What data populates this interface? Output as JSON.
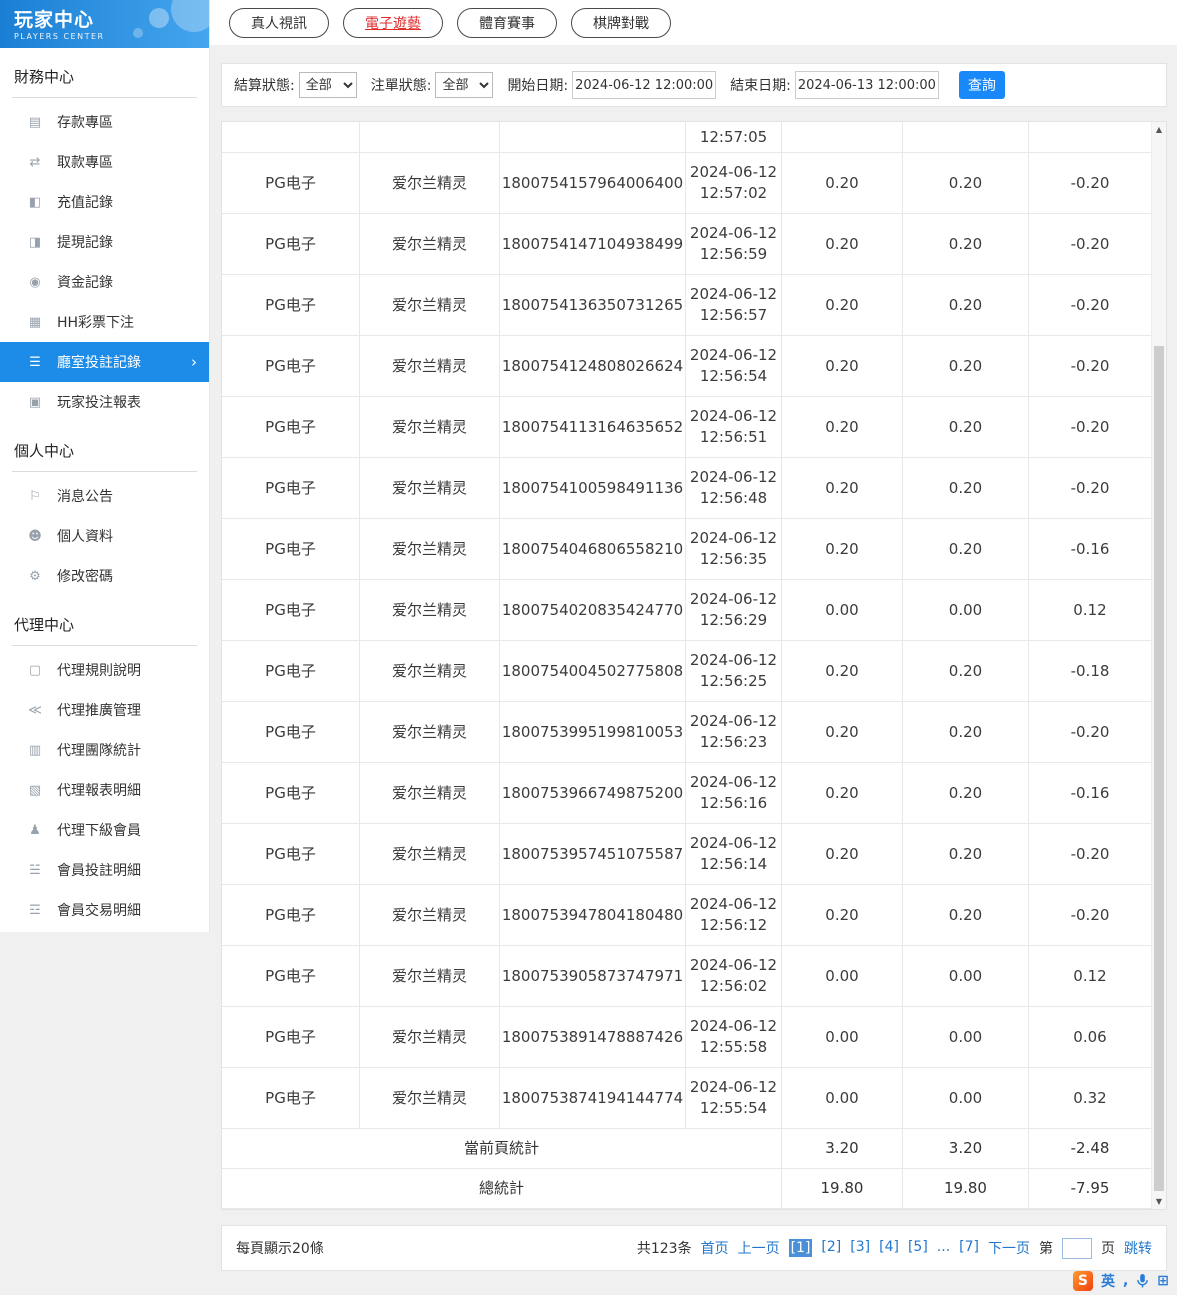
{
  "sidebar": {
    "logo_title": "玩家中心",
    "logo_subtitle": "PLAYERS CENTER",
    "sections": [
      {
        "id": "finance-center",
        "title": "財務中心",
        "items": [
          {
            "id": "deposit",
            "icon": "deposit-icon",
            "glyph": "▤",
            "label": "存款專區",
            "active": false
          },
          {
            "id": "withdraw",
            "icon": "withdraw-icon",
            "glyph": "⇄",
            "label": "取款專區",
            "active": false
          },
          {
            "id": "recharge-record",
            "icon": "recharge-record-icon",
            "glyph": "◧",
            "label": "充值記錄",
            "active": false
          },
          {
            "id": "withdrawal-record",
            "icon": "withdrawal-record-icon",
            "glyph": "◨",
            "label": "提現記錄",
            "active": false
          },
          {
            "id": "fund-record",
            "icon": "fund-record-icon",
            "glyph": "◉",
            "label": "資金記錄",
            "active": false
          },
          {
            "id": "hh-lottery-bet",
            "icon": "lottery-icon",
            "glyph": "▦",
            "label": "HH彩票下注",
            "active": false
          },
          {
            "id": "room-bet-record",
            "icon": "room-bet-record-icon",
            "glyph": "☰",
            "label": "廳室投註記錄",
            "active": true
          },
          {
            "id": "player-bet-report",
            "icon": "player-report-icon",
            "glyph": "▣",
            "label": "玩家投注報表",
            "active": false
          }
        ]
      },
      {
        "id": "personal-center",
        "title": "個人中心",
        "items": [
          {
            "id": "message-notice",
            "icon": "bell-icon",
            "glyph": "⚐",
            "label": "消息公告",
            "active": false
          },
          {
            "id": "personal-info",
            "icon": "user-icon",
            "glyph": "☻",
            "label": "個人資料",
            "active": false
          },
          {
            "id": "change-password",
            "icon": "gear-icon",
            "glyph": "⚙",
            "label": "修改密碼",
            "active": false
          }
        ]
      },
      {
        "id": "agent-center",
        "title": "代理中心",
        "items": [
          {
            "id": "agent-rules",
            "icon": "document-icon",
            "glyph": "▢",
            "label": "代理規則說明",
            "active": false
          },
          {
            "id": "agent-promotion",
            "icon": "share-icon",
            "glyph": "≪",
            "label": "代理推廣管理",
            "active": false
          },
          {
            "id": "agent-team-stats",
            "icon": "stats-icon",
            "glyph": "▥",
            "label": "代理團隊統計",
            "active": false
          },
          {
            "id": "agent-report-detail",
            "icon": "report-icon",
            "glyph": "▧",
            "label": "代理報表明細",
            "active": false
          },
          {
            "id": "agent-sub-members",
            "icon": "members-icon",
            "glyph": "♟",
            "label": "代理下級會員",
            "active": false
          },
          {
            "id": "member-bet-detail",
            "icon": "bet-detail-icon",
            "glyph": "☱",
            "label": "會員投註明細",
            "active": false
          },
          {
            "id": "member-transaction-detail",
            "icon": "transaction-icon",
            "glyph": "☲",
            "label": "會員交易明細",
            "active": false
          }
        ]
      }
    ]
  },
  "tabs": [
    {
      "id": "live-video",
      "label": "真人視訊",
      "active": false
    },
    {
      "id": "electronic-games",
      "label": "電子遊藝",
      "active": true
    },
    {
      "id": "sports-events",
      "label": "體育賽事",
      "active": false
    },
    {
      "id": "board-games",
      "label": "棋牌對戰",
      "active": false
    }
  ],
  "filters": {
    "settle_status_label": "結算狀態:",
    "settle_status_value": "全部",
    "order_status_label": "注單狀態:",
    "order_status_value": "全部",
    "start_label": "開始日期:",
    "start_value": "2024-06-12 12:00:00",
    "end_label": "結束日期:",
    "end_value": "2024-06-13 12:00:00",
    "search_label": "查詢"
  },
  "table": {
    "partial_top_time": "12:57:05",
    "rows": [
      {
        "platform": "PG电子",
        "game": "爱尔兰精灵",
        "order": "1800754157964006400",
        "date": "2024-06-12",
        "time": "12:57:02",
        "bet": "0.20",
        "valid": "0.20",
        "profit": "-0.20"
      },
      {
        "platform": "PG电子",
        "game": "爱尔兰精灵",
        "order": "1800754147104938499",
        "date": "2024-06-12",
        "time": "12:56:59",
        "bet": "0.20",
        "valid": "0.20",
        "profit": "-0.20"
      },
      {
        "platform": "PG电子",
        "game": "爱尔兰精灵",
        "order": "1800754136350731265",
        "date": "2024-06-12",
        "time": "12:56:57",
        "bet": "0.20",
        "valid": "0.20",
        "profit": "-0.20"
      },
      {
        "platform": "PG电子",
        "game": "爱尔兰精灵",
        "order": "1800754124808026624",
        "date": "2024-06-12",
        "time": "12:56:54",
        "bet": "0.20",
        "valid": "0.20",
        "profit": "-0.20"
      },
      {
        "platform": "PG电子",
        "game": "爱尔兰精灵",
        "order": "1800754113164635652",
        "date": "2024-06-12",
        "time": "12:56:51",
        "bet": "0.20",
        "valid": "0.20",
        "profit": "-0.20"
      },
      {
        "platform": "PG电子",
        "game": "爱尔兰精灵",
        "order": "1800754100598491136",
        "date": "2024-06-12",
        "time": "12:56:48",
        "bet": "0.20",
        "valid": "0.20",
        "profit": "-0.20"
      },
      {
        "platform": "PG电子",
        "game": "爱尔兰精灵",
        "order": "1800754046806558210",
        "date": "2024-06-12",
        "time": "12:56:35",
        "bet": "0.20",
        "valid": "0.20",
        "profit": "-0.16"
      },
      {
        "platform": "PG电子",
        "game": "爱尔兰精灵",
        "order": "1800754020835424770",
        "date": "2024-06-12",
        "time": "12:56:29",
        "bet": "0.00",
        "valid": "0.00",
        "profit": "0.12"
      },
      {
        "platform": "PG电子",
        "game": "爱尔兰精灵",
        "order": "1800754004502775808",
        "date": "2024-06-12",
        "time": "12:56:25",
        "bet": "0.20",
        "valid": "0.20",
        "profit": "-0.18"
      },
      {
        "platform": "PG电子",
        "game": "爱尔兰精灵",
        "order": "1800753995199810053",
        "date": "2024-06-12",
        "time": "12:56:23",
        "bet": "0.20",
        "valid": "0.20",
        "profit": "-0.20"
      },
      {
        "platform": "PG电子",
        "game": "爱尔兰精灵",
        "order": "1800753966749875200",
        "date": "2024-06-12",
        "time": "12:56:16",
        "bet": "0.20",
        "valid": "0.20",
        "profit": "-0.16"
      },
      {
        "platform": "PG电子",
        "game": "爱尔兰精灵",
        "order": "1800753957451075587",
        "date": "2024-06-12",
        "time": "12:56:14",
        "bet": "0.20",
        "valid": "0.20",
        "profit": "-0.20"
      },
      {
        "platform": "PG电子",
        "game": "爱尔兰精灵",
        "order": "1800753947804180480",
        "date": "2024-06-12",
        "time": "12:56:12",
        "bet": "0.20",
        "valid": "0.20",
        "profit": "-0.20"
      },
      {
        "platform": "PG电子",
        "game": "爱尔兰精灵",
        "order": "1800753905873747971",
        "date": "2024-06-12",
        "time": "12:56:02",
        "bet": "0.00",
        "valid": "0.00",
        "profit": "0.12"
      },
      {
        "platform": "PG电子",
        "game": "爱尔兰精灵",
        "order": "1800753891478887426",
        "date": "2024-06-12",
        "time": "12:55:58",
        "bet": "0.00",
        "valid": "0.00",
        "profit": "0.06"
      },
      {
        "platform": "PG电子",
        "game": "爱尔兰精灵",
        "order": "1800753874194144774",
        "date": "2024-06-12",
        "time": "12:55:54",
        "bet": "0.00",
        "valid": "0.00",
        "profit": "0.32"
      }
    ],
    "page_summary": {
      "label": "當前頁統計",
      "bet": "3.20",
      "valid": "3.20",
      "profit": "-2.48"
    },
    "total_summary": {
      "label": "總統計",
      "bet": "19.80",
      "valid": "19.80",
      "profit": "-7.95"
    }
  },
  "pagination": {
    "per_page_text": "每頁顯示20條",
    "total_text": "共123条",
    "first_label": "首页",
    "prev_label": "上一页",
    "pages": [
      "1",
      "2",
      "3",
      "4",
      "5"
    ],
    "active_page": "1",
    "ellipsis": "...",
    "tail_page": "7",
    "next_label": "下一页",
    "jump_before": "第",
    "jump_after": "页",
    "jump_label": "跳转"
  },
  "ime": {
    "logo": "S",
    "lang": "英",
    "punct": ","
  }
}
